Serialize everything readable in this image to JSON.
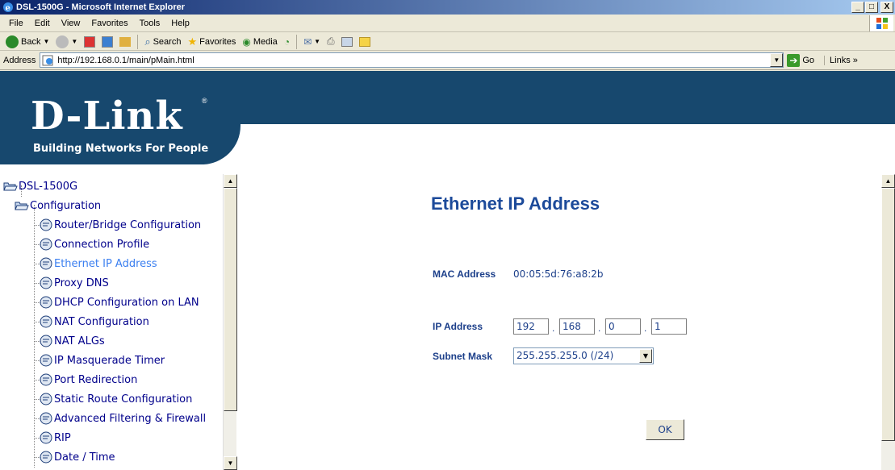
{
  "window": {
    "title": "DSL-1500G - Microsoft Internet Explorer",
    "min": "_",
    "max": "□",
    "close": "X"
  },
  "menu": [
    "File",
    "Edit",
    "View",
    "Favorites",
    "Tools",
    "Help"
  ],
  "toolbar": {
    "back": "Back",
    "search": "Search",
    "favorites": "Favorites",
    "media": "Media"
  },
  "address": {
    "label": "Address",
    "url": "http://192.168.0.1/main/pMain.html",
    "go": "Go",
    "links": "Links »"
  },
  "brand": {
    "logo": "D-Link",
    "registered": "®",
    "tagline": "Building Networks For People"
  },
  "tree": {
    "root": "DSL-1500G",
    "group": "Configuration",
    "items": [
      "Router/Bridge Configuration",
      "Connection Profile",
      "Ethernet IP Address",
      "Proxy DNS",
      "DHCP Configuration on LAN",
      "NAT Configuration",
      "NAT ALGs",
      "IP Masquerade Timer",
      "Port Redirection",
      "Static Route Configuration",
      "Advanced Filtering & Firewall",
      "RIP",
      "Date / Time"
    ],
    "active_item": "Ethernet IP Address"
  },
  "page": {
    "title": "Ethernet IP Address",
    "mac_label": "MAC Address",
    "mac_value": "00:05:5d:76:a8:2b",
    "ip_label": "IP Address",
    "ip_octets": [
      "192",
      "168",
      "0",
      "1"
    ],
    "subnet_label": "Subnet Mask",
    "subnet_value": "255.255.255.0 (/24)",
    "ok_label": "OK"
  },
  "colors": {
    "brand_blue": "#17486e",
    "link_blue": "#00008b",
    "active_link": "#3b7ff0",
    "label_blue": "#1c3f8a"
  }
}
